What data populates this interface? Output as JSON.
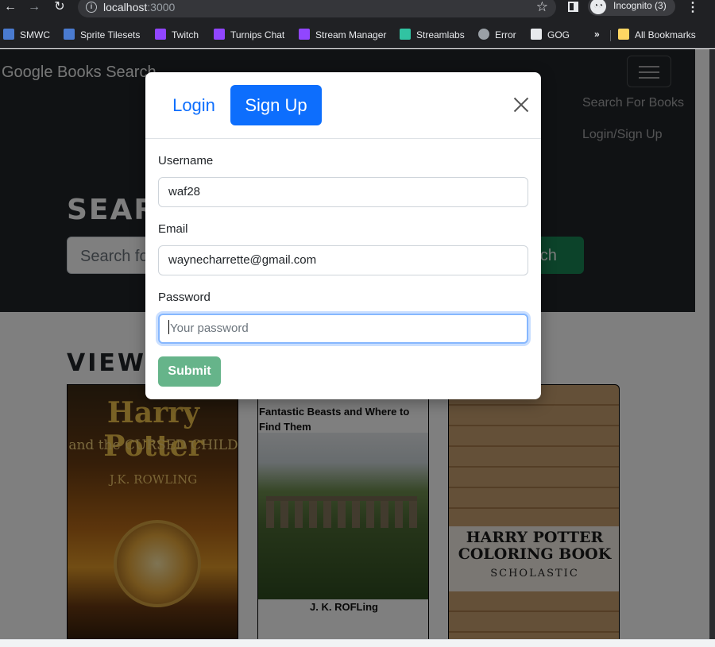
{
  "browser": {
    "url_host": "localhost",
    "url_port": ":3000",
    "incognito_label": "Incognito (3)",
    "icons": {
      "back": "arrow-left-icon",
      "forward": "arrow-right-icon",
      "reload": "reload-icon",
      "bookmark_star": "star-icon",
      "menu": "kebab-menu-icon"
    },
    "bookmarks": [
      {
        "label": "SMWC",
        "icon": "smwc-icon",
        "color": "#4a7bd0"
      },
      {
        "label": "Sprite Tilesets",
        "icon": "smwc-icon",
        "color": "#4a7bd0"
      },
      {
        "label": "Twitch",
        "icon": "twitch-icon",
        "color": "#9146ff"
      },
      {
        "label": "Turnips Chat",
        "icon": "twitch-icon",
        "color": "#9146ff"
      },
      {
        "label": "Stream Manager",
        "icon": "twitch-icon",
        "color": "#9146ff"
      },
      {
        "label": "Streamlabs",
        "icon": "streamlabs-icon",
        "color": "#31c3a2"
      },
      {
        "label": "Error",
        "icon": "globe-icon",
        "color": "#9aa0a6"
      },
      {
        "label": "GOG",
        "icon": "gog-icon",
        "color": "#e8eaed"
      }
    ],
    "overflow_label": "»",
    "all_bookmarks_label": "All Bookmarks"
  },
  "app": {
    "brand": "Google Books Search",
    "nav_links": [
      "Search For Books",
      "Login/Sign Up"
    ],
    "hero_title": "SEAR",
    "search_placeholder": "Search fo",
    "search_button": "arch",
    "section_title": "VIEW",
    "books": [
      {
        "cover_lines": [
          "Harry Potter",
          "and the CURSED CHILD",
          "J.K. ROWLING"
        ]
      },
      {
        "title": "Fantastic Beasts and Where to Find Them",
        "author": "J. K. ROFLing"
      },
      {
        "cover_lines": [
          "HARRY POTTER COLORING BOOK",
          "SCHOLASTIC"
        ]
      }
    ]
  },
  "modal": {
    "tabs": {
      "login": "Login",
      "signup": "Sign Up"
    },
    "active_tab": "signup",
    "fields": {
      "username": {
        "label": "Username",
        "value": "waf28"
      },
      "email": {
        "label": "Email",
        "value": "waynecharrette@gmail.com"
      },
      "password": {
        "label": "Password",
        "placeholder": "Your password",
        "value": ""
      }
    },
    "submit": "Submit"
  },
  "colors": {
    "primary": "#0d6efd",
    "success": "#198754",
    "submit_disabled": "#66b48a",
    "hero_bg": "#212529"
  }
}
